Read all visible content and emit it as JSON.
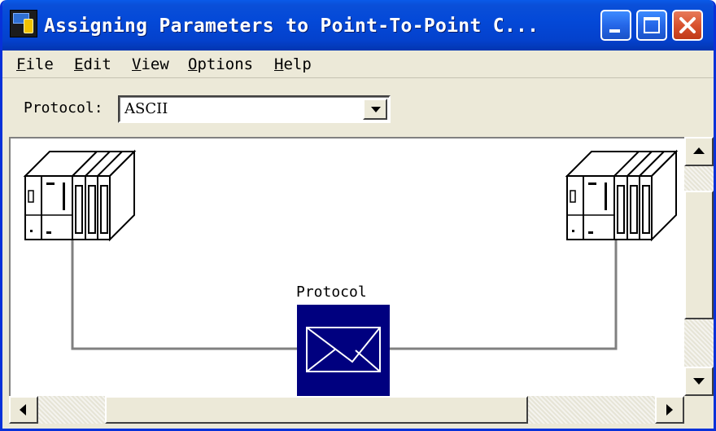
{
  "window": {
    "title": "Assigning Parameters to Point-To-Point C...",
    "title_color": "#ffffff",
    "titlebar_color": "#0449d8"
  },
  "titlebar_buttons": {
    "minimize_icon": "minimize-icon",
    "maximize_icon": "maximize-icon",
    "close_icon": "close-icon"
  },
  "menubar": {
    "items": [
      {
        "key": "F",
        "rest": "ile"
      },
      {
        "key": "E",
        "rest": "dit"
      },
      {
        "key": "V",
        "rest": "iew"
      },
      {
        "key": "O",
        "rest": "ptions"
      },
      {
        "key": "H",
        "rest": "elp"
      }
    ]
  },
  "toolbar": {
    "protocol_label": "Protocol:",
    "protocol_value": "ASCII"
  },
  "diagram": {
    "protocol_caption": "Protocol",
    "left_device_icon": "plc-rack-icon",
    "right_device_icon": "plc-rack-icon",
    "protocol_icon": "envelope-icon",
    "protocol_box_color": "#00007f",
    "link_color": "#808080"
  }
}
